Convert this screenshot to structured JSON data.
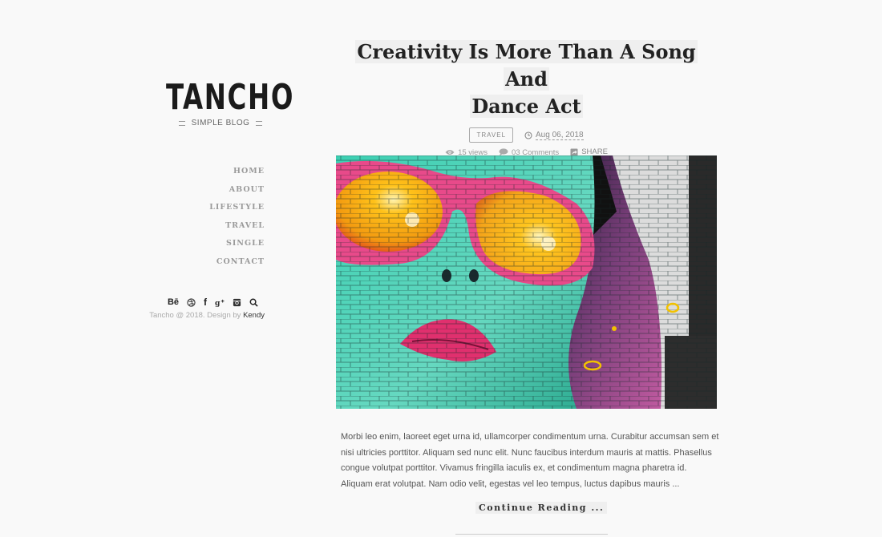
{
  "site": {
    "logo": "TANCHO",
    "tagline": "SIMPLE BLOG"
  },
  "nav": {
    "items": [
      {
        "label": "HOME"
      },
      {
        "label": "ABOUT"
      },
      {
        "label": "LIFESTYLE"
      },
      {
        "label": "TRAVEL"
      },
      {
        "label": "SINGLE"
      },
      {
        "label": "CONTACT"
      }
    ]
  },
  "social": {
    "icons": [
      {
        "name": "behance-icon",
        "glyph": "Bē"
      },
      {
        "name": "dribbble-icon",
        "glyph": "⊛"
      },
      {
        "name": "facebook-icon",
        "glyph": "f"
      },
      {
        "name": "google-plus-icon",
        "glyph": "g+"
      },
      {
        "name": "instagram-icon",
        "glyph": "◙"
      },
      {
        "name": "search-icon",
        "glyph": "⌕"
      }
    ]
  },
  "footer": {
    "copyright": "Tancho @ 2018. Design by ",
    "author": "Kendy"
  },
  "post": {
    "title_line1": "Creativity Is More Than A Song And",
    "title_line2": "Dance Act",
    "category": "TRAVEL",
    "date": "Aug 06, 2018",
    "views": "15 views",
    "comments": "03 Comments",
    "share": "SHARE",
    "image_alt": "Graffiti mural of a woman with pink sunglasses",
    "excerpt": "Morbi leo enim, laoreet eget urna id, ullamcorper condimentum urna. Curabitur accumsan sem et nisi ultricies porttitor. Aliquam sed nunc elit. Nunc faucibus interdum mauris at mattis. Phasellus congue volutpat porttitor. Vivamus fringilla iaculis ex, et condimentum magna pharetra id. Aliquam erat volutpat. Nam odio velit, egestas vel leo tempus, luctus dapibus mauris ...",
    "continue_label": "Continue Reading ..."
  },
  "colors": {
    "background": "#f9f9f9",
    "title_highlight": "#efefef",
    "text": "#555555",
    "nav": "#9a9a9a"
  }
}
